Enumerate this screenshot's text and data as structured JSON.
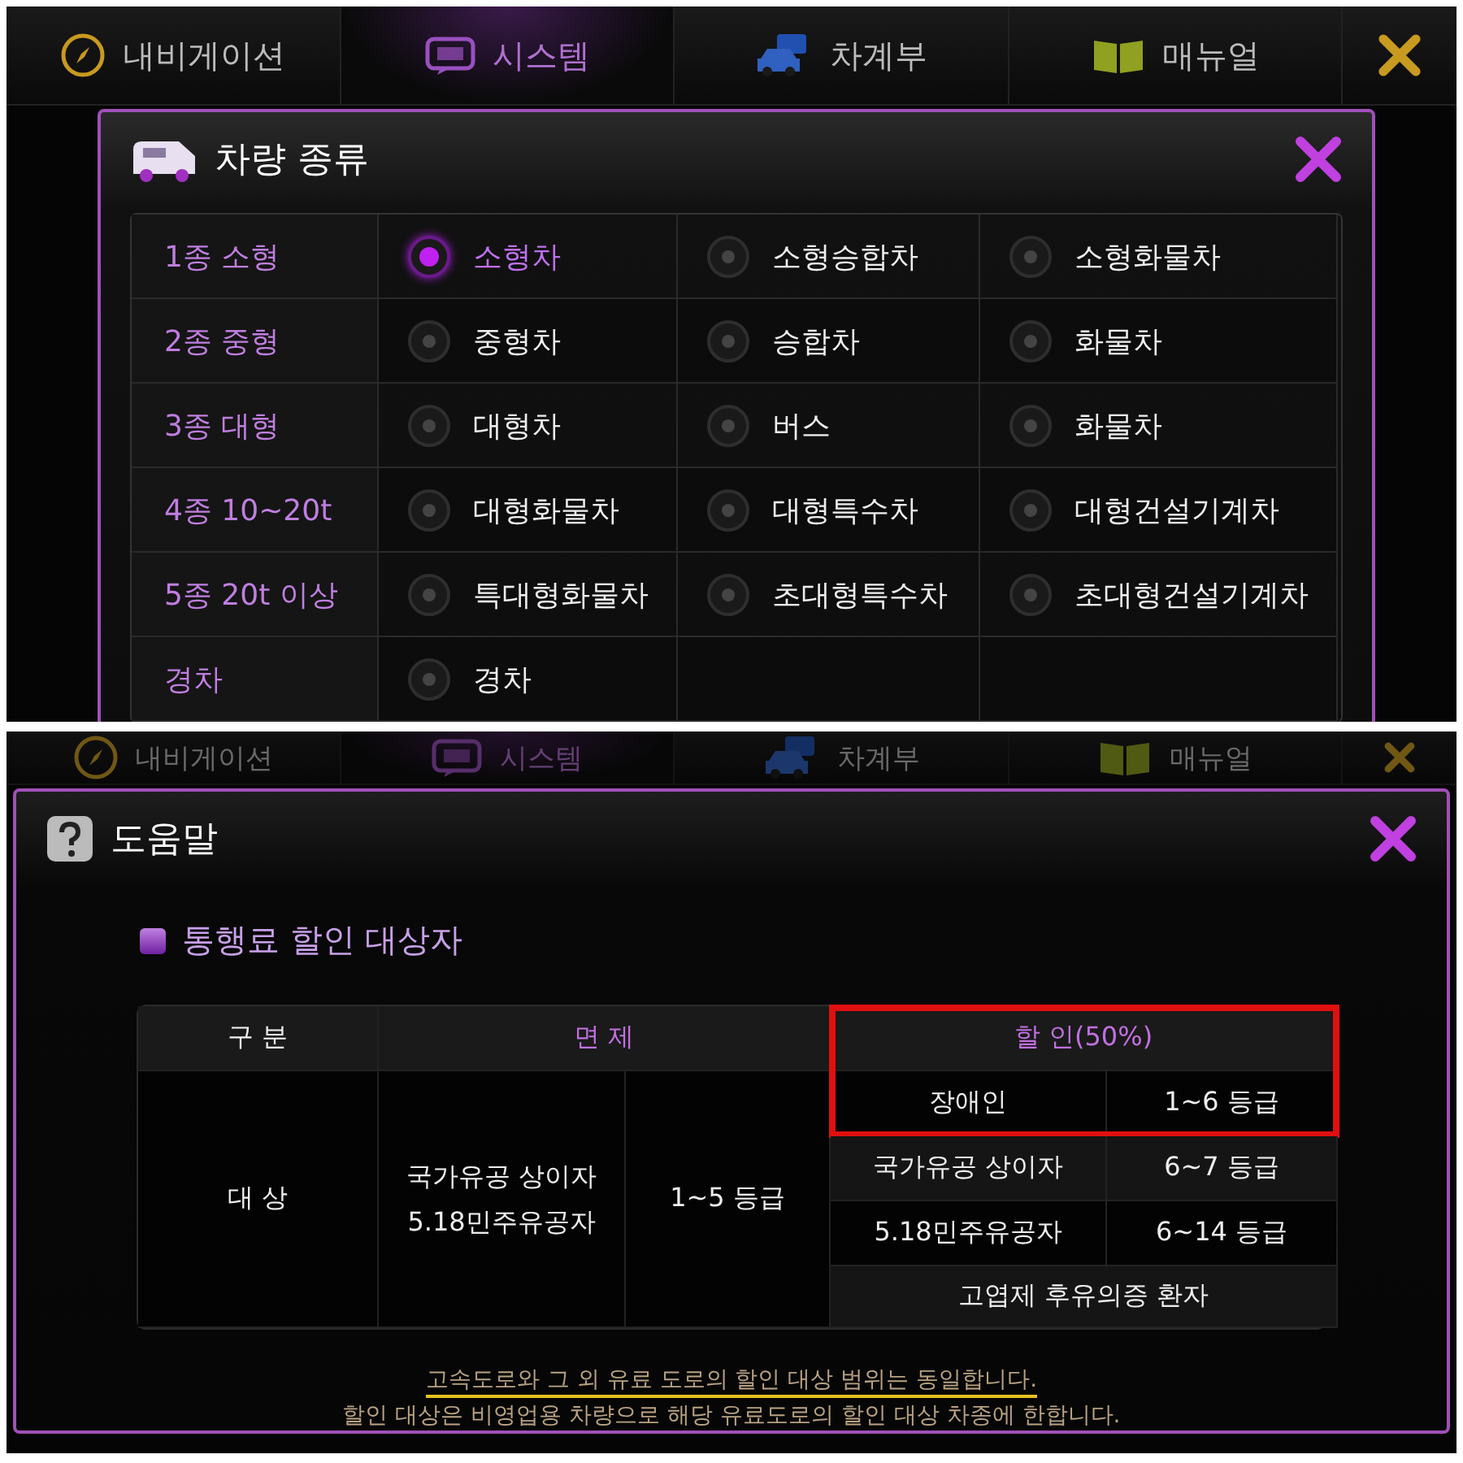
{
  "vehicle_screen": {
    "tabs": [
      {
        "label": "내비게이션",
        "selected": false
      },
      {
        "label": "시스템",
        "selected": true
      },
      {
        "label": "차계부",
        "selected": false
      },
      {
        "label": "매뉴얼",
        "selected": false
      }
    ],
    "dialog": {
      "title": "차량 종류",
      "rows": [
        {
          "label": "1종 소형",
          "options": [
            {
              "label": "소형차",
              "selected": true
            },
            {
              "label": "소형승합차",
              "selected": false
            },
            {
              "label": "소형화물차",
              "selected": false
            }
          ]
        },
        {
          "label": "2종 중형",
          "options": [
            {
              "label": "중형차",
              "selected": false
            },
            {
              "label": "승합차",
              "selected": false
            },
            {
              "label": "화물차",
              "selected": false
            }
          ]
        },
        {
          "label": "3종 대형",
          "options": [
            {
              "label": "대형차",
              "selected": false
            },
            {
              "label": "버스",
              "selected": false
            },
            {
              "label": "화물차",
              "selected": false
            }
          ]
        },
        {
          "label": "4종 10~20t",
          "options": [
            {
              "label": "대형화물차",
              "selected": false
            },
            {
              "label": "대형특수차",
              "selected": false
            },
            {
              "label": "대형건설기계차",
              "selected": false
            }
          ]
        },
        {
          "label": "5종 20t 이상",
          "options": [
            {
              "label": "특대형화물차",
              "selected": false
            },
            {
              "label": "초대형특수차",
              "selected": false
            },
            {
              "label": "초대형건설기계차",
              "selected": false
            }
          ]
        },
        {
          "label": "경차",
          "options": [
            {
              "label": "경차",
              "selected": false
            }
          ]
        }
      ]
    }
  },
  "help_screen": {
    "tabs": [
      {
        "label": "내비게이션",
        "selected": false
      },
      {
        "label": "시스템",
        "selected": true
      },
      {
        "label": "차계부",
        "selected": false
      },
      {
        "label": "매뉴얼",
        "selected": false
      }
    ],
    "dialog": {
      "title": "도움말",
      "section": "통행료 할인 대상자",
      "table": {
        "head": {
          "category": "구 분",
          "exempt": "면 제",
          "discount": "할 인(50%)"
        },
        "row_label": "대 상",
        "exempt_groups": "국가유공 상이자\n5.18민주유공자",
        "exempt_grade": "1~5 등급",
        "discount_rows": [
          {
            "group": "장애인",
            "grade": "1~6 등급"
          },
          {
            "group": "국가유공 상이자",
            "grade": "6~7 등급"
          },
          {
            "group": "5.18민주유공자",
            "grade": "6~14 등급"
          }
        ],
        "discount_last": "고엽제 후유의증 환자",
        "highlight_frame": true
      },
      "notes": [
        {
          "text": "고속도로와 그 외 유료 도로의 할인 대상 범위는 동일합니다.",
          "underlined": true
        },
        {
          "text": "할인 대상은 비영업용 차량으로 해당 유료도로의 할인 대상 차종에 한합니다.",
          "underlined": false
        }
      ]
    }
  }
}
